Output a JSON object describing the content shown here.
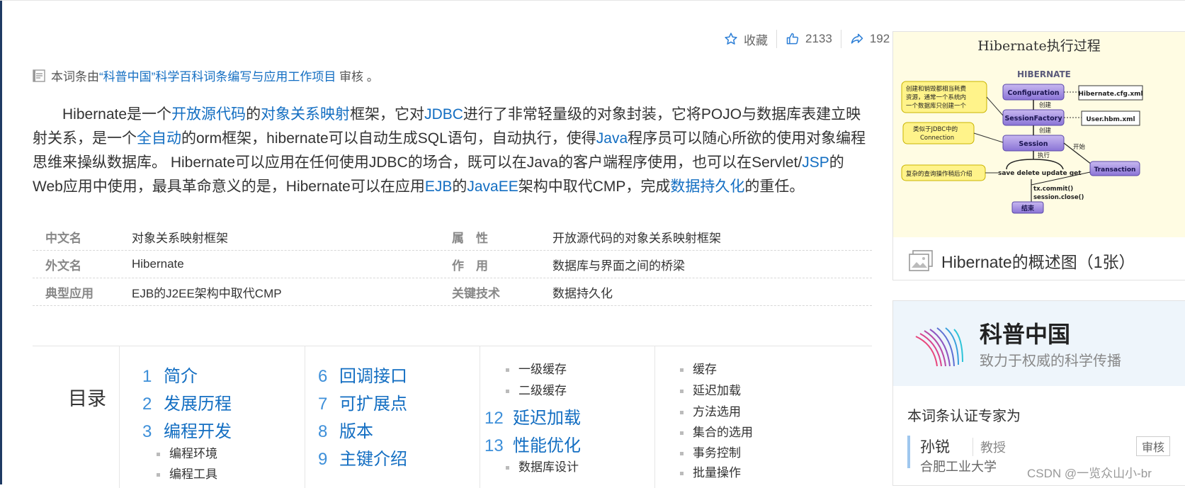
{
  "actions": {
    "favorite_label": "收藏",
    "like_count": "2133",
    "share_count": "192"
  },
  "review": {
    "prefix": "本词条由",
    "link": "“科普中国”科学百科词条编写与应用工作项目",
    "suffix": " 审核 。"
  },
  "paragraph": [
    {
      "t": "Hibernate是一个"
    },
    {
      "t": "开放源代码",
      "link": true
    },
    {
      "t": "的"
    },
    {
      "t": "对象关系映射",
      "link": true
    },
    {
      "t": "框架，它对"
    },
    {
      "t": "JDBC",
      "link": true
    },
    {
      "t": "进行了非常轻量级的对象封装，它将POJO与数据库表建立映射关系，是一个"
    },
    {
      "t": "全自动",
      "link": true
    },
    {
      "t": "的orm框架，hibernate可以自动生成SQL语句，自动执行，使得"
    },
    {
      "t": "Java",
      "link": true
    },
    {
      "t": "程序员可以随心所欲的使用对象编程思维来操纵数据库。 Hibernate可以应用在任何使用JDBC的场合，既可以在Java的客户端程序使用，也可以在Servlet/"
    },
    {
      "t": "JSP",
      "link": true
    },
    {
      "t": "的Web应用中使用，最具革命意义的是，Hibernate可以在应用"
    },
    {
      "t": "EJB",
      "link": true
    },
    {
      "t": "的"
    },
    {
      "t": "JavaEE",
      "link": true
    },
    {
      "t": "架构中取代CMP，完成"
    },
    {
      "t": "数据持久化",
      "link": true
    },
    {
      "t": "的重任。"
    }
  ],
  "info": [
    {
      "k": "中文名",
      "v": "对象关系映射框架",
      "k2": "属　性",
      "v2": "开放源代码的对象关系映射框架",
      "v2link": false
    },
    {
      "k": "外文名",
      "v": "Hibernate",
      "k2": "作　用",
      "v2": "数据库与界面之间的桥梁",
      "v2link": false
    },
    {
      "k": "典型应用",
      "v": "EJB的J2EE架构中取代CMP",
      "k2": "关键技术",
      "v2": "数据持久化",
      "v2link": true
    }
  ],
  "catalog": {
    "title": "目录",
    "items": [
      {
        "n": "1",
        "label": "简介"
      },
      {
        "n": "2",
        "label": "发展历程"
      },
      {
        "n": "3",
        "label": "编程开发"
      },
      {
        "n": "6",
        "label": "回调接口"
      },
      {
        "n": "7",
        "label": "可扩展点"
      },
      {
        "n": "8",
        "label": "版本"
      },
      {
        "n": "9",
        "label": "主键介绍"
      },
      {
        "n": "12",
        "label": "延迟加载"
      },
      {
        "n": "13",
        "label": "性能优化"
      }
    ],
    "subs": [
      "编程环境",
      "编程工具",
      "一级缓存",
      "二级缓存",
      "数据库设计",
      "缓存",
      "延迟加载",
      "方法选用",
      "集合的选用",
      "事务控制",
      "批量操作"
    ]
  },
  "album": {
    "caption": "Hibernate的概述图（1张）",
    "diagram": {
      "title": "Hibernate执行过程",
      "logo": "HIBERNATE",
      "note1": [
        "创建和销毁都相当耗费",
        "资源，通常一个系统内",
        "一个数据库只创建一个"
      ],
      "note2": [
        "类似于JDBC中的",
        "Connection"
      ],
      "note3": "复杂的查询操作稍后介绍",
      "configuration": "Configuration",
      "session_factory": "SessionFactory",
      "session": "Session",
      "cfg_file": "Hibernate.cfg.xml",
      "hbm_file": "User.hbm.xml",
      "create1": "创建",
      "create2": "创建",
      "execute": "执行",
      "start": "开始",
      "ops": "save delete update get",
      "transaction": "Transaction",
      "commit": "tx.commit()",
      "close": "session.close()",
      "end": "结束"
    }
  },
  "kepu": {
    "brand": "科普中国",
    "slogan": "致力于权威的科学传播",
    "expert_title": "本词条认证专家为",
    "expert_name": "孙锐",
    "expert_rank": "教授",
    "expert_org": "合肥工业大学",
    "badge": "审核"
  },
  "watermark": "CSDN @一览众山小-br"
}
